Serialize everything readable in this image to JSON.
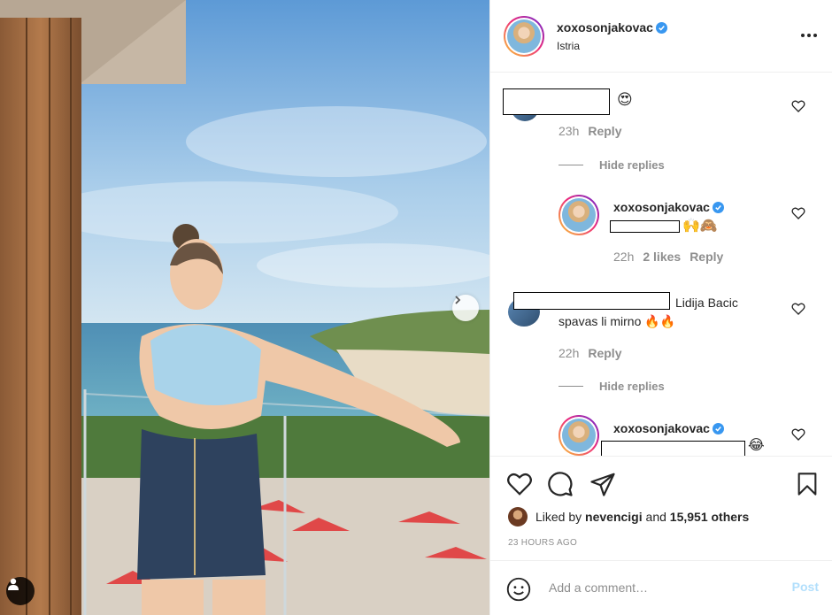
{
  "post": {
    "username": "xoxosonjakovac",
    "location": "Istria"
  },
  "comments": [
    {
      "emoji": "😍",
      "time": "23h",
      "reply_label": "Reply",
      "hide_replies": "Hide replies",
      "replies": [
        {
          "username": "xoxosonjakovac",
          "emoji": "🙌🙈",
          "time": "22h",
          "likes": "2 likes",
          "reply_label": "Reply"
        }
      ]
    },
    {
      "text_line1": "Lidija Bacic",
      "text_line2": "spavas li mirno 🔥🔥",
      "time": "22h",
      "reply_label": "Reply",
      "hide_replies": "Hide replies",
      "replies": [
        {
          "username": "xoxosonjakovac",
          "emoji": "😂"
        }
      ]
    }
  ],
  "likes": {
    "prefix": "Liked by",
    "liker": "nevencigi",
    "conjunction": "and",
    "others": "15,951 others"
  },
  "timestamp": "23 HOURS AGO",
  "composer": {
    "placeholder": "Add a comment…",
    "post_label": "Post"
  },
  "icons": {
    "like": "heart-icon",
    "comment": "comment-icon",
    "share": "share-icon",
    "save": "bookmark-icon",
    "emoji": "smiley-icon",
    "more": "more-options-icon"
  },
  "colors": {
    "verified": "#3897f0",
    "post_button": "#b2dffc",
    "secondary_text": "#8e8e8e"
  }
}
